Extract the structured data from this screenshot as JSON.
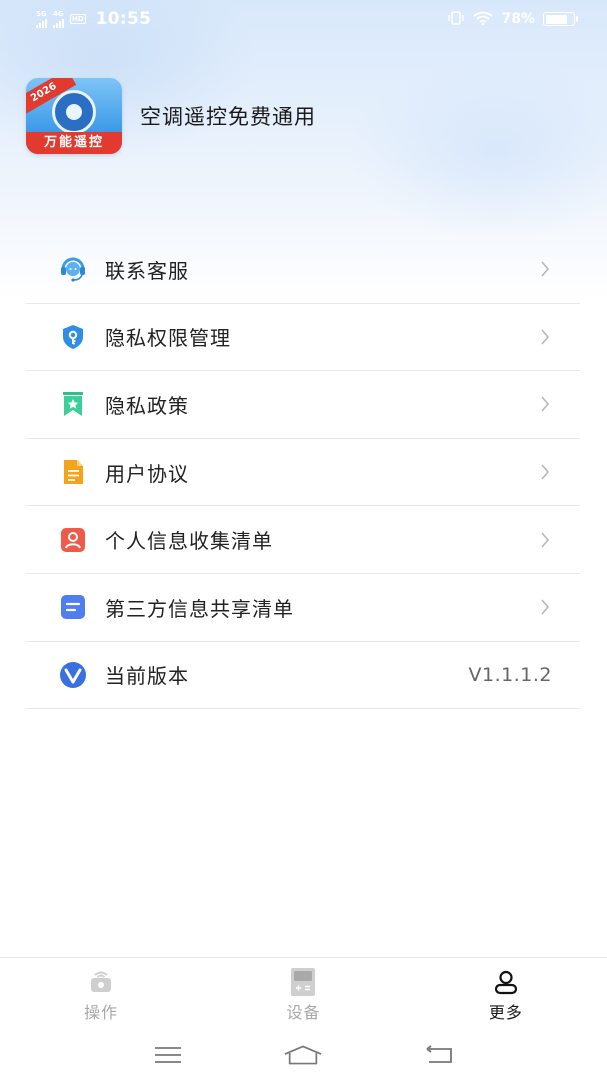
{
  "status_bar": {
    "network_1": "5G",
    "network_2": "4G",
    "hd": "HD",
    "time": "10:55",
    "battery_percent_text": "78%",
    "battery_level": 0.78
  },
  "app": {
    "logo_badge": "2026",
    "logo_text": "万能遥控",
    "name": "空调遥控免费通用"
  },
  "menu": {
    "items": [
      {
        "label": "联系客服",
        "icon": "customer-service-icon"
      },
      {
        "label": "隐私权限管理",
        "icon": "privacy-shield-key-icon"
      },
      {
        "label": "隐私政策",
        "icon": "policy-bookmark-icon"
      },
      {
        "label": "用户协议",
        "icon": "agreement-document-icon"
      },
      {
        "label": "个人信息收集清单",
        "icon": "personal-info-icon"
      },
      {
        "label": "第三方信息共享清单",
        "icon": "third-party-share-icon"
      }
    ],
    "version": {
      "label": "当前版本",
      "value": "V1.1.1.2",
      "icon": "version-v-icon"
    }
  },
  "tabs": [
    {
      "label": "操作",
      "icon": "remote-operate-icon",
      "active": false
    },
    {
      "label": "设备",
      "icon": "device-calculator-icon",
      "active": false
    },
    {
      "label": "更多",
      "icon": "user-more-icon",
      "active": true
    }
  ],
  "colors": {
    "accent_blue": "#3a8ee6",
    "brand_red": "#e23a2e",
    "text_primary": "#222222",
    "text_muted": "#a8a8a8"
  }
}
